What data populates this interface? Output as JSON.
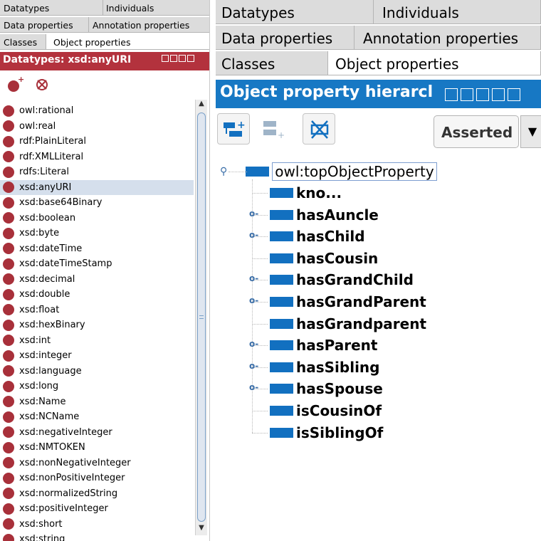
{
  "left": {
    "tabs_row1": [
      "Datatypes",
      "Individuals"
    ],
    "tabs_row2": [
      "Data properties",
      "Annotation properties"
    ],
    "tabs_row3": [
      "Classes",
      "Object properties"
    ],
    "header_title": "Datatypes: xsd:anyURI",
    "toolbar": {
      "add_icon": "add-datatype-icon",
      "delete_icon": "delete-datatype-icon"
    },
    "datatypes": [
      "owl:rational",
      "owl:real",
      "rdf:PlainLiteral",
      "rdf:XMLLiteral",
      "rdfs:Literal",
      "xsd:anyURI",
      "xsd:base64Binary",
      "xsd:boolean",
      "xsd:byte",
      "xsd:dateTime",
      "xsd:dateTimeStamp",
      "xsd:decimal",
      "xsd:double",
      "xsd:float",
      "xsd:hexBinary",
      "xsd:int",
      "xsd:integer",
      "xsd:language",
      "xsd:long",
      "xsd:Name",
      "xsd:NCName",
      "xsd:negativeInteger",
      "xsd:NMTOKEN",
      "xsd:nonNegativeInteger",
      "xsd:nonPositiveInteger",
      "xsd:normalizedString",
      "xsd:positiveInteger",
      "xsd:short",
      "xsd:string"
    ],
    "selected_datatype": "xsd:anyURI"
  },
  "right": {
    "tabs_row1": [
      "Datatypes",
      "Individuals"
    ],
    "tabs_row2": [
      "Data properties",
      "Annotation properties"
    ],
    "tabs_row3": [
      "Classes",
      "Object properties"
    ],
    "header_title": "Object property hierarcl",
    "toolbar": {
      "mode": "Asserted"
    },
    "root": "owl:topObjectProperty",
    "properties": [
      {
        "label": "kno...",
        "expandable": false
      },
      {
        "label": "hasAuncle",
        "expandable": true
      },
      {
        "label": "hasChild",
        "expandable": true
      },
      {
        "label": "hasCousin",
        "expandable": false
      },
      {
        "label": "hasGrandChild",
        "expandable": true
      },
      {
        "label": "hasGrandParent",
        "expandable": true
      },
      {
        "label": "hasGrandparent",
        "expandable": false
      },
      {
        "label": "hasParent",
        "expandable": true
      },
      {
        "label": "hasSibling",
        "expandable": true
      },
      {
        "label": "hasSpouse",
        "expandable": true
      },
      {
        "label": "isCousinOf",
        "expandable": false
      },
      {
        "label": "isSiblingOf",
        "expandable": false
      }
    ]
  },
  "colors": {
    "datatype_accent": "#b3323d",
    "objprop_accent": "#1778c4",
    "selection": "#d5dfec"
  }
}
